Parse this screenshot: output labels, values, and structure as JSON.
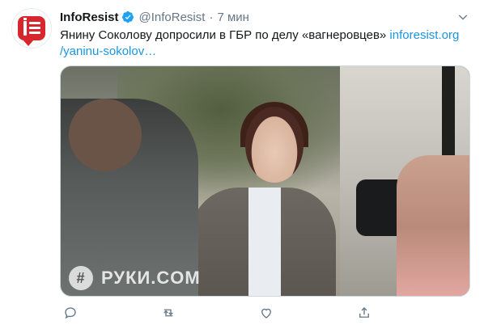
{
  "tweet": {
    "display_name": "InfoResist",
    "handle": "@InfoResist",
    "separator": "·",
    "time": "7 мин",
    "text_prefix": "Янину Соколову допросили в ГБР по делу «вагнеровцев» ",
    "link_part1": "inforesist.org",
    "link_part2": "/yaninu-sokolov…",
    "media_watermark": "РУКИ.COM"
  },
  "colors": {
    "brand_red": "#d7262e",
    "link_blue": "#1b95e0",
    "muted_gray": "#657786",
    "verified_blue": "#1da1f2"
  },
  "icons": {
    "verified": "verified-badge-icon",
    "caret": "chevron-down-icon",
    "reply": "reply-icon",
    "retweet": "retweet-icon",
    "like": "heart-icon",
    "share": "share-icon"
  }
}
